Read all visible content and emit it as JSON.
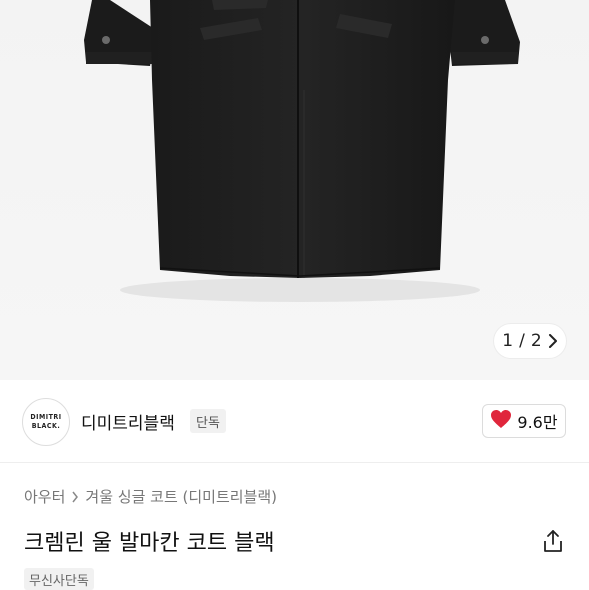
{
  "gallery": {
    "current": "1",
    "separator": "/",
    "total": "2",
    "next_icon": "chevron-right-icon"
  },
  "brand": {
    "logo_line1": "DIMITRI",
    "logo_line2": "BLACK.",
    "name": "디미트리블랙",
    "badge": "단독"
  },
  "like": {
    "icon": "heart-icon",
    "count": "9.6만",
    "color": "#e0263c"
  },
  "breadcrumb": {
    "items": [
      "아우터",
      "겨울 싱글 코트 (디미트리블랙)"
    ]
  },
  "product": {
    "title": "크렘린 울 발마칸 코트 블랙",
    "share_icon": "share-icon",
    "tag": "무신사단독"
  }
}
